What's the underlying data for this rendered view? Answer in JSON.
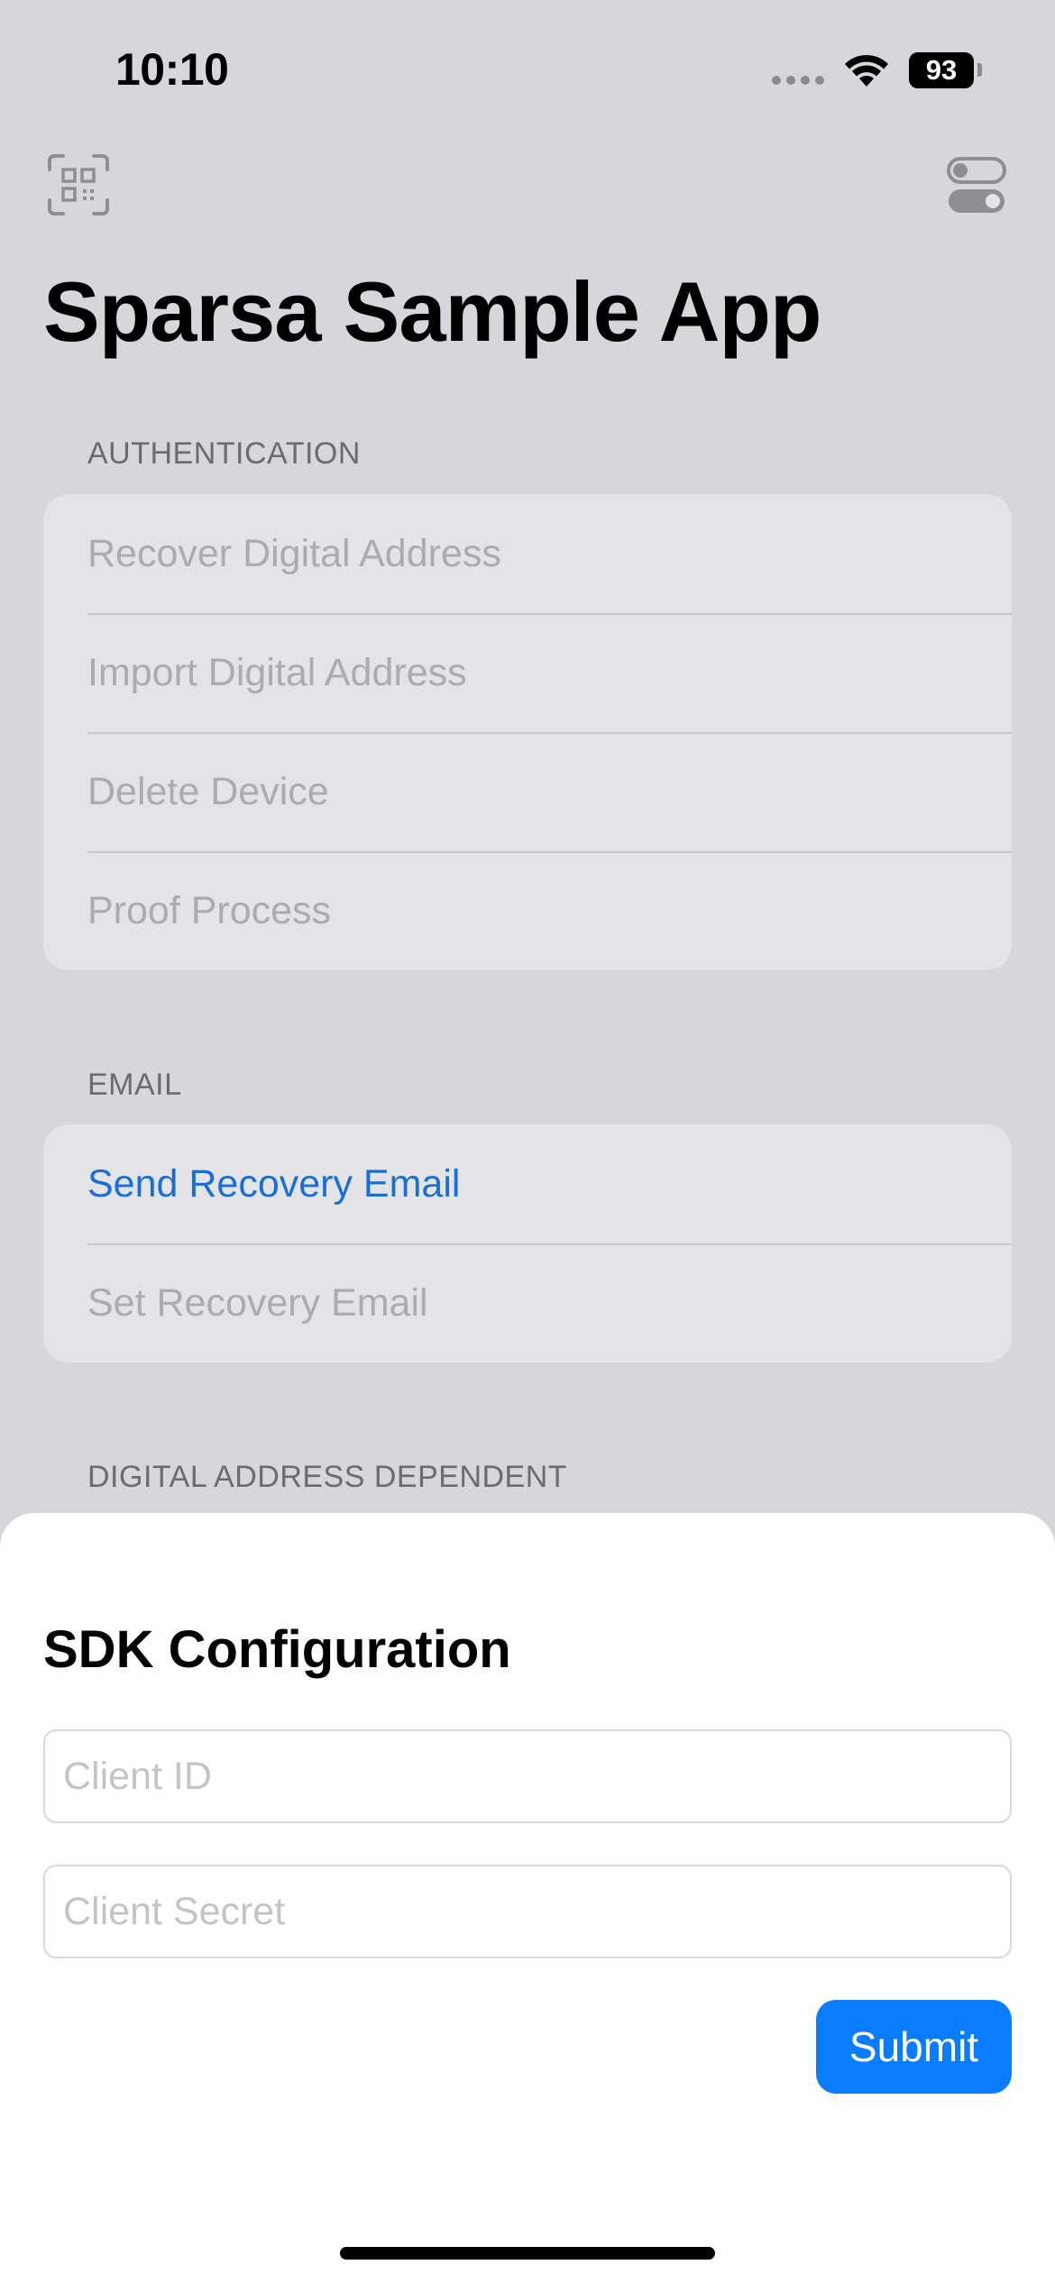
{
  "status_bar": {
    "time": "10:10",
    "battery": "93",
    "icons": [
      "signal-dots-icon",
      "wifi-icon",
      "battery-icon"
    ]
  },
  "toolbar": {
    "left_icon": "qr-code-scanner-icon",
    "right_icon": "toggles-icon"
  },
  "page_title": "Sparsa Sample App",
  "sections": [
    {
      "header": "AUTHENTICATION",
      "items": [
        {
          "label": "Recover Digital Address",
          "enabled": false
        },
        {
          "label": "Import Digital Address",
          "enabled": false
        },
        {
          "label": "Delete Device",
          "enabled": false
        },
        {
          "label": "Proof Process",
          "enabled": false
        }
      ]
    },
    {
      "header": "EMAIL",
      "items": [
        {
          "label": "Send Recovery Email",
          "enabled": true
        },
        {
          "label": "Set Recovery Email",
          "enabled": false
        }
      ]
    },
    {
      "header": "DIGITAL ADDRESS DEPENDENT",
      "items": []
    }
  ],
  "sheet": {
    "title": "SDK Configuration",
    "client_id": {
      "value": "",
      "placeholder": "Client ID"
    },
    "client_secret": {
      "value": "",
      "placeholder": "Client Secret"
    },
    "submit_label": "Submit"
  },
  "colors": {
    "background": "#d6d6db",
    "group_background": "#e4e4e6",
    "disabled_text": "#ababb0",
    "link_text": "#1a6fd4",
    "accent": "#0a7cff"
  }
}
